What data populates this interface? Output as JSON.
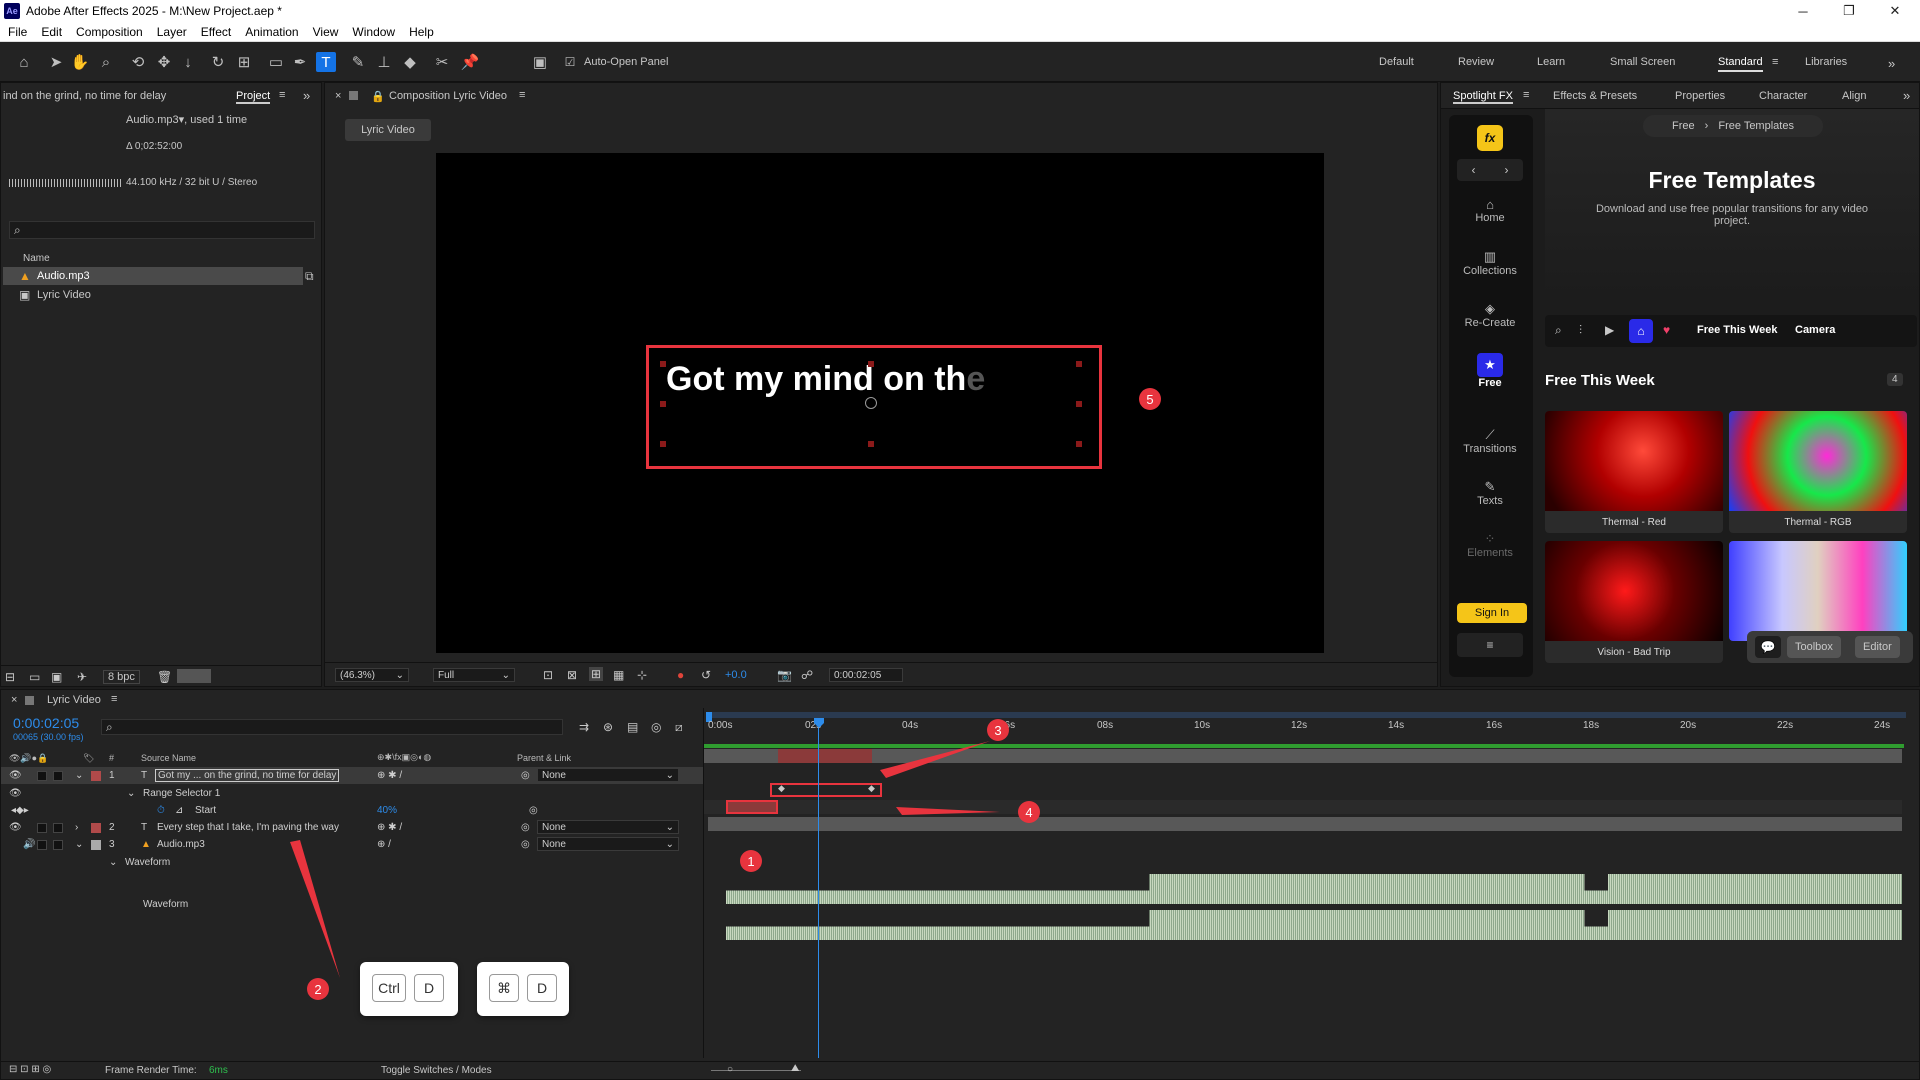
{
  "window": {
    "title": "Adobe After Effects 2025 - M:\\New Project.aep *",
    "logo": "Ae"
  },
  "menu": [
    "File",
    "Edit",
    "Composition",
    "Layer",
    "Effect",
    "Animation",
    "View",
    "Window",
    "Help"
  ],
  "toolbar": {
    "auto_open_panel": "Auto-Open Panel",
    "auto_open_checked": true
  },
  "workspaces": [
    "Default",
    "Review",
    "Learn",
    "Small Screen",
    "Standard",
    "Libraries"
  ],
  "active_workspace": "Standard",
  "project": {
    "header_text": "ind on the grind, no time for delay",
    "tab": "Project",
    "asset_name": "Audio.mp3",
    "asset_usage": ", used 1 time",
    "duration": "Δ 0;02:52:00",
    "audio_info": "44.100 kHz / 32 bit U / Stereo",
    "name_col": "Name",
    "items": [
      {
        "name": "Audio.mp3",
        "icon": "audio-file-icon",
        "selected": true
      },
      {
        "name": "Lyric Video",
        "icon": "composition-icon",
        "selected": false
      }
    ],
    "bpc": "8 bpc"
  },
  "composition": {
    "tab": "Composition Lyric Video",
    "subtab": "Lyric Video",
    "preview_text_solid": "Got my mind on th",
    "preview_text_faded": "e",
    "zoom": "(46.3%)",
    "resolution": "Full",
    "exposure": "+0.0",
    "timecode": "0:00:02:05"
  },
  "spotlight": {
    "tabs": [
      "Spotlight FX",
      "Effects & Presets",
      "Properties",
      "Character",
      "Align"
    ],
    "breadcrumb": [
      "Free",
      "Free Templates"
    ],
    "hero_title": "Free Templates",
    "hero_desc": "Download and use free popular transitions for any video project.",
    "rail": [
      "Home",
      "Collections",
      "Re-Create",
      "Free",
      "Transitions",
      "Texts",
      "Elements"
    ],
    "filters": [
      "Free This Week",
      "Camera"
    ],
    "section_title": "Free This Week",
    "section_count": "4",
    "cards": [
      "Thermal - Red",
      "Thermal - RGB",
      "Vision - Bad Trip",
      ""
    ],
    "sign_in": "Sign In",
    "toolbox": "Toolbox",
    "editor": "Editor"
  },
  "timeline": {
    "tab": "Lyric Video",
    "timecode": "0:00:02:05",
    "frame_info": "00065 (30.00 fps)",
    "col_source": "Source Name",
    "col_parent": "Parent & Link",
    "layers": [
      {
        "num": "1",
        "name": "Got my ... on the grind,  no time for delay",
        "parent": "None",
        "type": "text"
      },
      {
        "num": "2",
        "name": "Every step that I take,  I'm paving the way",
        "parent": "None",
        "type": "text"
      },
      {
        "num": "3",
        "name": "Audio.mp3",
        "parent": "None",
        "type": "audio"
      }
    ],
    "range_selector": "Range Selector 1",
    "start_label": "Start",
    "start_value": "40%",
    "waveform_group": "Waveform",
    "waveform_label": "Waveform",
    "ruler": [
      "0:00s",
      "02s",
      "04s",
      "06s",
      "08s",
      "10s",
      "12s",
      "14s",
      "16s",
      "18s",
      "20s",
      "22s",
      "24s"
    ],
    "frame_render_label": "Frame Render Time:",
    "frame_render_value": "6ms",
    "toggle_label": "Toggle Switches / Modes"
  },
  "annotations": [
    "1",
    "2",
    "3",
    "4",
    "5"
  ],
  "shortcuts": {
    "win": [
      "Ctrl",
      "D"
    ],
    "mac": [
      "⌘",
      "D"
    ]
  }
}
